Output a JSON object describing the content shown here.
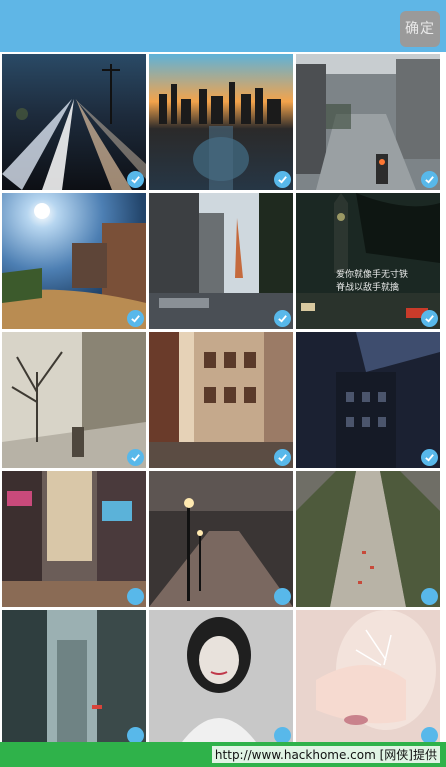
{
  "header": {
    "confirm_label": "确定"
  },
  "tiles": [
    {
      "name": "tile-highway-night-lights",
      "selected": true
    },
    {
      "name": "tile-city-skyline-sunset",
      "selected": true
    },
    {
      "name": "tile-city-street-traffic-light",
      "selected": true
    },
    {
      "name": "tile-sunny-castle-path",
      "selected": true
    },
    {
      "name": "tile-paris-street-eiffel",
      "selected": true,
      "caption": [
        "爱你就像手无寸铁",
        "脊战以敌手就擒"
      ]
    },
    {
      "name": "tile-london-big-ben-night",
      "selected": true
    },
    {
      "name": "tile-winter-trees-street",
      "selected": true
    },
    {
      "name": "tile-european-buildings",
      "selected": true
    },
    {
      "name": "tile-dark-buildings",
      "selected": true
    },
    {
      "name": "tile-times-square",
      "selected": false
    },
    {
      "name": "tile-street-lamps-avenue",
      "selected": false
    },
    {
      "name": "tile-aerial-boulevard",
      "selected": false
    },
    {
      "name": "tile-skyscrapers-fog",
      "selected": false
    },
    {
      "name": "tile-girl-portrait-bw",
      "selected": false
    },
    {
      "name": "tile-girl-hand-closeup",
      "selected": false
    }
  ],
  "footer": {
    "watermark": "http://www.hackhome.com [网侠]提供"
  }
}
